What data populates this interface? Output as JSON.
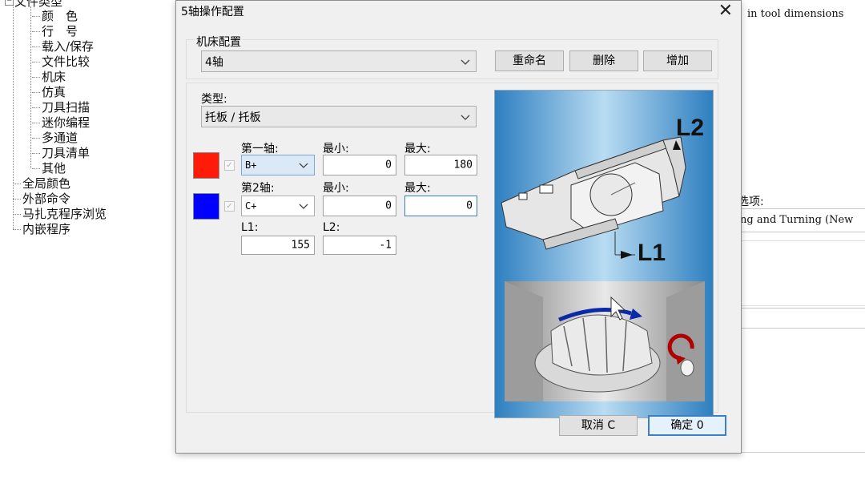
{
  "tree": {
    "root_label": "文件类型",
    "children": [
      "颜　色",
      "行　号",
      "载入/保存",
      "文件比较",
      "机床",
      "仿真",
      "刀具扫描",
      "迷你编程",
      "多通道",
      "刀具清单",
      "其他"
    ],
    "top_items": [
      "全局颜色",
      "外部命令",
      "马扎克程序浏览",
      "内嵌程序"
    ]
  },
  "background": {
    "right_text_1": "in tool dimensions",
    "right_label": "选项:",
    "right_text_2": "ng and Turning (New"
  },
  "dialog": {
    "title": "5轴操作配置",
    "close_glyph": "✕",
    "machine_config": {
      "label": "机床配置",
      "selected": "4轴",
      "rename_label": "重命名",
      "delete_label": "删除",
      "add_label": "增加"
    },
    "type": {
      "label": "类型:",
      "selected": "托板 / 托板"
    },
    "axis1": {
      "label": "第一轴:",
      "value": "B+",
      "min_label": "最小:",
      "min": "0",
      "max_label": "最大:",
      "max": "180",
      "color": "#ff1a0a"
    },
    "axis2": {
      "label": "第2轴:",
      "value": "C+",
      "min_label": "最小:",
      "min": "0",
      "max_label": "最大:",
      "max": "0",
      "color": "#0000ff"
    },
    "l1": {
      "label": "L1:",
      "value": "155"
    },
    "l2": {
      "label": "L2:",
      "value": "-1"
    },
    "preview": {
      "label_l1": "L1",
      "label_l2": "L2"
    },
    "cancel_label": "取消 C",
    "ok_label": "确定 0"
  }
}
